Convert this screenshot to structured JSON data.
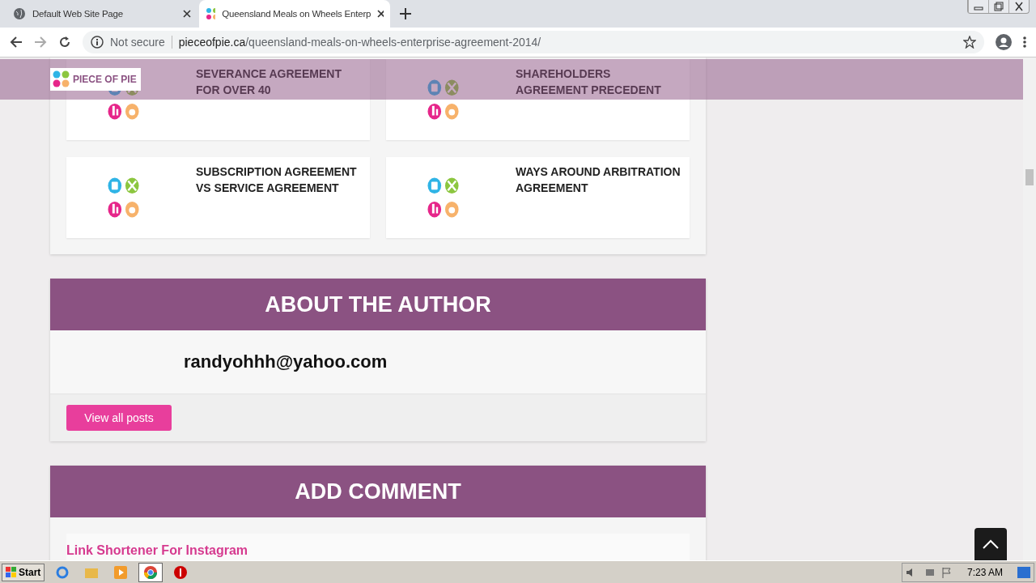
{
  "browser": {
    "tabs": [
      {
        "title": "Default Web Site Page",
        "selected": false
      },
      {
        "title": "Queensland Meals on Wheels Enterp",
        "selected": true
      }
    ],
    "security": "Not secure",
    "url_host": "pieceofpie.ca",
    "url_path": "/queensland-meals-on-wheels-enterprise-agreement-2014/"
  },
  "site_header": {
    "logo": "PIECE OF PIE"
  },
  "related_posts": [
    {
      "title": "SEVERANCE AGREEMENT FOR OVER 40"
    },
    {
      "title": "SHAREHOLDERS AGREEMENT PRECEDENT"
    },
    {
      "title": "SUBSCRIPTION AGREEMENT VS SERVICE AGREEMENT"
    },
    {
      "title": "WAYS AROUND ARBITRATION AGREEMENT"
    }
  ],
  "about_author": {
    "heading": "ABOUT THE AUTHOR",
    "name": "randyohhh@yahoo.com",
    "button": "View all posts"
  },
  "add_comment": {
    "heading": "ADD COMMENT",
    "link": "Link Shortener For Instagram"
  },
  "taskbar": {
    "start": "Start",
    "clock": "7:23 AM"
  }
}
